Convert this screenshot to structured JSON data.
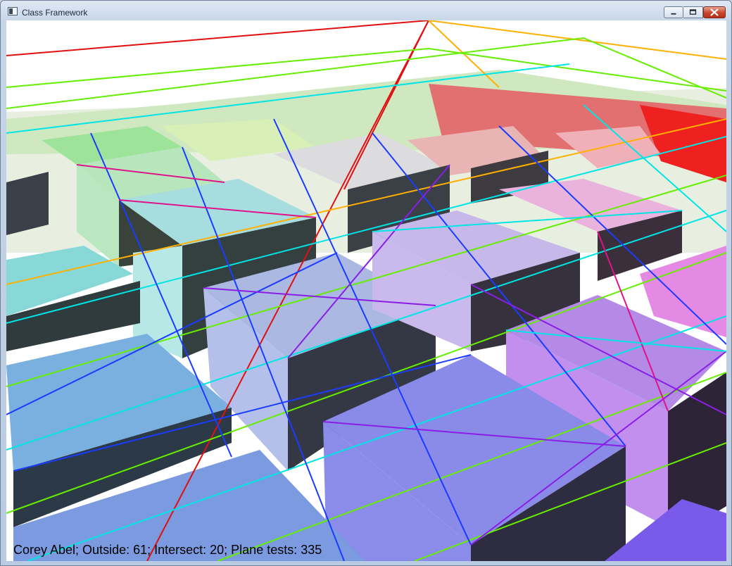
{
  "window": {
    "title": "Class Framework"
  },
  "status": {
    "text": "Corey Abel; Outside: 61; Intersect: 20; Plane tests: 335"
  },
  "colors": {
    "background": "#ffffff",
    "wire_red": "#e01010",
    "wire_orange": "#ffb000",
    "wire_green": "#66ee00",
    "wire_cyan": "#00e5e5",
    "wire_blue": "#1a3cff",
    "wire_purple": "#8a1ee6"
  },
  "icons": {
    "app": "app-window-icon",
    "minimize": "minimize-icon",
    "maximize": "maximize-icon",
    "close": "close-icon"
  }
}
